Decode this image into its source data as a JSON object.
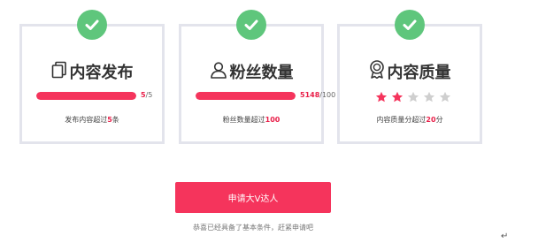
{
  "cards": [
    {
      "title": "内容发布",
      "icon": "copy-icon",
      "progress": {
        "fraction": 1.0,
        "value": "5",
        "total": "/5"
      },
      "desc": {
        "pre": "发布内容超过",
        "value": "5",
        "post": "条"
      }
    },
    {
      "title": "粉丝数量",
      "icon": "user-icon",
      "progress": {
        "fraction": 1.0,
        "value": "5148",
        "total": "/100"
      },
      "desc": {
        "pre": "粉丝数量超过",
        "value": "100",
        "post": ""
      }
    },
    {
      "title": "内容质量",
      "icon": "award-icon",
      "rating": {
        "filled": 2,
        "total": 5
      },
      "desc": {
        "pre": "内容质量分超过",
        "value": "20",
        "post": "分"
      }
    }
  ],
  "apply_button": "申请大V达人",
  "note": "恭喜已经具备了基本条件，赶紧申请吧",
  "return_mark": "↵",
  "colors": {
    "accent": "#f5345c",
    "check": "#5fc67c",
    "border": "#e3e4ec",
    "star_empty": "#cfcfcf"
  }
}
